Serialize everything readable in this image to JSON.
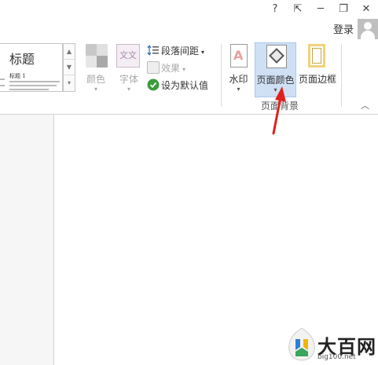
{
  "window": {
    "help_label": "?",
    "ribbon_display_label": "⇱",
    "minimize_label": "─",
    "restore_label": "❐",
    "close_label": "✕"
  },
  "account": {
    "signin_label": "登录"
  },
  "ribbon": {
    "style_gallery": {
      "title": "标题",
      "subtitle": "标题 1"
    },
    "colors_label": "颜色",
    "fonts_label": "字体",
    "fonts_icon_text": "文文",
    "paragraph_spacing_label": "段落间距",
    "effects_label": "效果",
    "set_default_label": "设为默认值",
    "watermark_label": "水印",
    "page_color_label": "页面颜色",
    "page_border_label": "页面边框",
    "page_background_group_label": "页面背景"
  },
  "watermark": {
    "text": "大百网",
    "url": "big100.net"
  },
  "colors": {
    "accent_red": "#e0201b",
    "page_color_highlight": "#cfe0f5"
  }
}
